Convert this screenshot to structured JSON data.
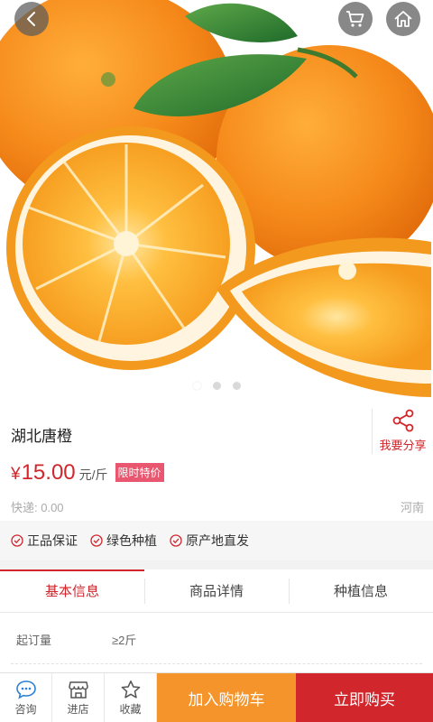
{
  "product": {
    "title": "湖北唐橙",
    "currency": "¥",
    "price": "15.00",
    "unit": "元/斤",
    "promo_badge": "限时特价",
    "shipping": "快递: 0.00",
    "origin": "河南",
    "carousel": {
      "count": 3,
      "active_index": 0
    }
  },
  "share": {
    "label": "我要分享",
    "icon": "share-icon"
  },
  "top_nav": {
    "back_icon": "chevron-left-icon",
    "cart_icon": "cart-icon",
    "home_icon": "home-icon"
  },
  "guarantees": [
    {
      "label": "正品保证",
      "icon": "check-circle-icon"
    },
    {
      "label": "绿色种植",
      "icon": "check-circle-icon"
    },
    {
      "label": "原产地直发",
      "icon": "check-circle-icon"
    }
  ],
  "tabs": [
    {
      "label": "基本信息",
      "active": true
    },
    {
      "label": "商品详情",
      "active": false
    },
    {
      "label": "种植信息",
      "active": false
    }
  ],
  "specs": [
    {
      "label": "起订量",
      "value": "≥2斤"
    }
  ],
  "bottom_bar": {
    "consult": {
      "label": "咨询",
      "icon": "chat-icon"
    },
    "store": {
      "label": "进店",
      "icon": "store-icon"
    },
    "favorite": {
      "label": "收藏",
      "icon": "star-icon"
    },
    "add_to_cart": "加入购物车",
    "buy_now": "立即购买"
  },
  "colors": {
    "accent_red": "#d0262c",
    "cart_orange": "#f4942a",
    "badge_pink": "#e8566f"
  }
}
